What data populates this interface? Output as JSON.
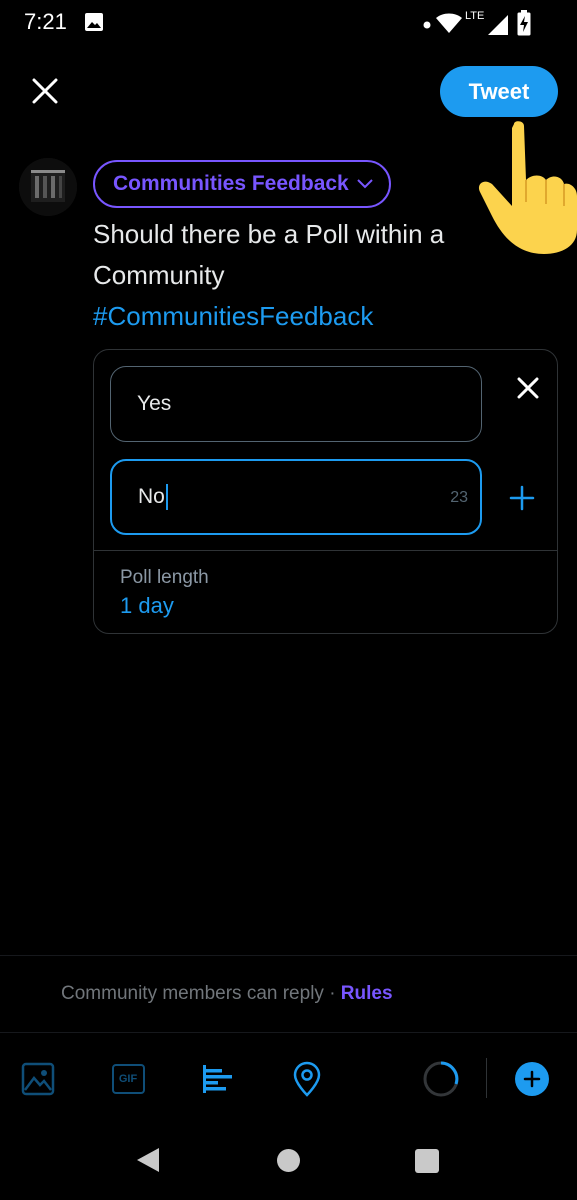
{
  "status_bar": {
    "time": "7:21",
    "network_label": "LTE",
    "icons": [
      "image-icon",
      "dot-icon",
      "wifi-icon",
      "signal-icon",
      "battery-charging-icon"
    ]
  },
  "header": {
    "close_icon": "close-icon",
    "tweet_label": "Tweet",
    "pointer_icon": "pointing-hand-icon"
  },
  "compose": {
    "avatar_icon": "user-avatar",
    "community_label": "Communities Feedback",
    "community_chevron": "chevron-down-icon",
    "text_lines": [
      "Should there be a Poll within a",
      "Community"
    ],
    "hashtag": "#CommunitiesFeedback"
  },
  "poll": {
    "options": [
      {
        "value": "Yes",
        "active": false
      },
      {
        "value": "No",
        "active": true
      }
    ],
    "char_count": "23",
    "remove_icon": "close-icon",
    "add_icon": "plus-icon",
    "length_label": "Poll length",
    "length_value": "1 day"
  },
  "reply_notice": {
    "text": "Community members can reply · ",
    "rules_link": "Rules"
  },
  "toolbar": {
    "items": [
      "image-icon",
      "gif-icon",
      "poll-icon",
      "location-icon",
      "progress-ring-icon",
      "add-thread-icon"
    ],
    "gif_label": "GIF"
  },
  "colors": {
    "background": "#000000",
    "accent_blue": "#1d9bf0",
    "community_purple": "#7856ff",
    "text": "#e7e9ea",
    "muted": "#71767b"
  }
}
